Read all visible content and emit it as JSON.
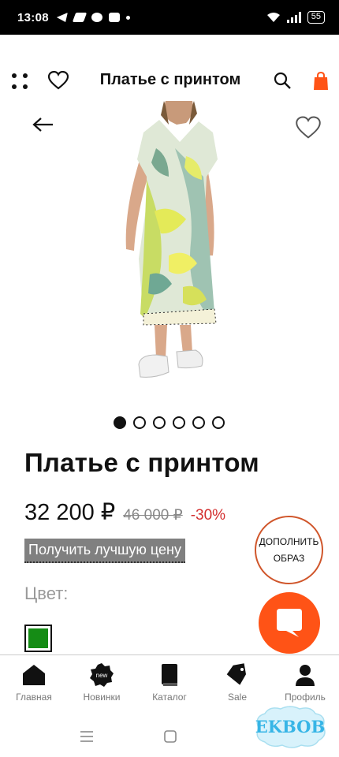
{
  "status_bar": {
    "time": "13:08",
    "battery": "55"
  },
  "header": {
    "title": "Платье с принтом"
  },
  "gallery": {
    "slides": 6,
    "active_index": 0
  },
  "product": {
    "name": "Платье с принтом",
    "price_current": "32 200 ₽",
    "price_old": "46 000 ₽",
    "discount": "-30%",
    "best_price_label": "Получить лучшую цену",
    "color_label": "Цвет:",
    "selected_color": "#158c15"
  },
  "complement_button": {
    "line1": "ДОПОЛНИТЬ",
    "line2": "ОБРАЗ"
  },
  "bottom_nav": {
    "items": [
      {
        "label": "Главная",
        "icon": "home-icon"
      },
      {
        "label": "Новинки",
        "icon": "new-badge-icon"
      },
      {
        "label": "Каталог",
        "icon": "book-icon"
      },
      {
        "label": "Sale",
        "icon": "tag-icon"
      },
      {
        "label": "Профиль",
        "icon": "user-icon"
      }
    ]
  },
  "watermark": {
    "text": "EKBOB"
  },
  "colors": {
    "accent": "#ff5316",
    "complement_border": "#d0562b",
    "discount": "#d32f2f"
  }
}
